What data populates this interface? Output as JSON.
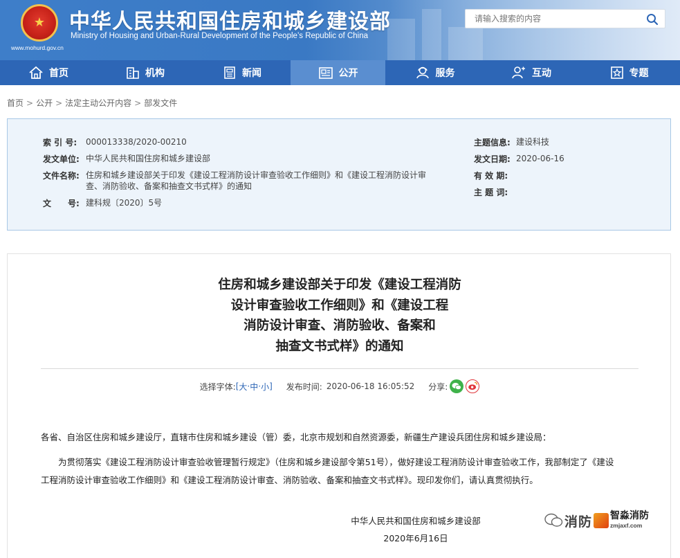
{
  "header": {
    "title": "中华人民共和国住房和城乡建设部",
    "subtitle": "Ministry of Housing and Urban-Rural Development of the People’s Republic of China",
    "url": "www.mohurd.gov.cn",
    "search_placeholder": "请输入搜索的内容"
  },
  "nav": {
    "items": [
      {
        "label": "首页",
        "icon": "home-icon"
      },
      {
        "label": "机构",
        "icon": "building-icon"
      },
      {
        "label": "新闻",
        "icon": "newspaper-icon"
      },
      {
        "label": "公开",
        "icon": "document-icon",
        "active": true
      },
      {
        "label": "服务",
        "icon": "service-icon"
      },
      {
        "label": "互动",
        "icon": "interaction-icon"
      },
      {
        "label": "专题",
        "icon": "star-icon"
      }
    ]
  },
  "breadcrumb": {
    "items": [
      "首页",
      "公开",
      "法定主动公开内容",
      "部发文件"
    ],
    "separator": ">"
  },
  "info": {
    "index_label": "索 引 号:",
    "index_value": "000013338/2020-00210",
    "issuer_label": "发文单位:",
    "issuer_value": "中华人民共和国住房和城乡建设部",
    "filename_label": "文件名称:",
    "filename_value": "住房和城乡建设部关于印发《建设工程消防设计审查验收工作细则》和《建设工程消防设计审查、消防验收、备案和抽查文书式样》的通知",
    "docno_label": "文　　号:",
    "docno_value": "建科规〔2020〕5号",
    "topic_label": "主题信息:",
    "topic_value": "建设科技",
    "date_label": "发文日期:",
    "date_value": "2020-06-16",
    "validity_label": "有 效 期:",
    "validity_value": "",
    "keywords_label": "主 题 词:",
    "keywords_value": ""
  },
  "article": {
    "title_lines": [
      "住房和城乡建设部关于印发《建设工程消防",
      "设计审查验收工作细则》和《建设工程",
      "消防设计审查、消防验收、备案和",
      "抽查文书式样》的通知"
    ],
    "font_size_label": "选择字体:",
    "font_bracket_open": "[",
    "font_large": "大",
    "font_dot1": "·",
    "font_medium": "中",
    "font_dot2": "·",
    "font_small": "小",
    "font_bracket_close": "]",
    "publish_label": "发布时间:",
    "publish_time": "2020-06-18 16:05:52",
    "share_label": "分享:",
    "recipients": "各省、自治区住房和城乡建设厅，直辖市住房和城乡建设（管）委，北京市规划和自然资源委，新疆生产建设兵团住房和城乡建设局：",
    "paragraph_line1": "为贯彻落实《建设工程消防设计审查验收管理暂行规定》（住房和城乡建设部令第51号），做好建设工程消防设计审查验收工作，我部制定了《建设",
    "paragraph_line2": "工程消防设计审查验收工作细则》和《建设工程消防设计审查、消防验收、备案和抽查文书式样》。现印发你们，请认真贯彻执行。",
    "signature": "中华人民共和国住房和城乡建设部",
    "sign_date": "2020年6月16日"
  },
  "watermark": {
    "text1": "消防",
    "brand": "智淼消防",
    "url": "zmjaxf.com"
  },
  "colors": {
    "header_blue": "#3e7ec9",
    "nav_blue": "#2d66b6",
    "nav_active": "#5a8ed0",
    "info_bg": "#edf4fb",
    "link_blue": "#2d66b6"
  }
}
